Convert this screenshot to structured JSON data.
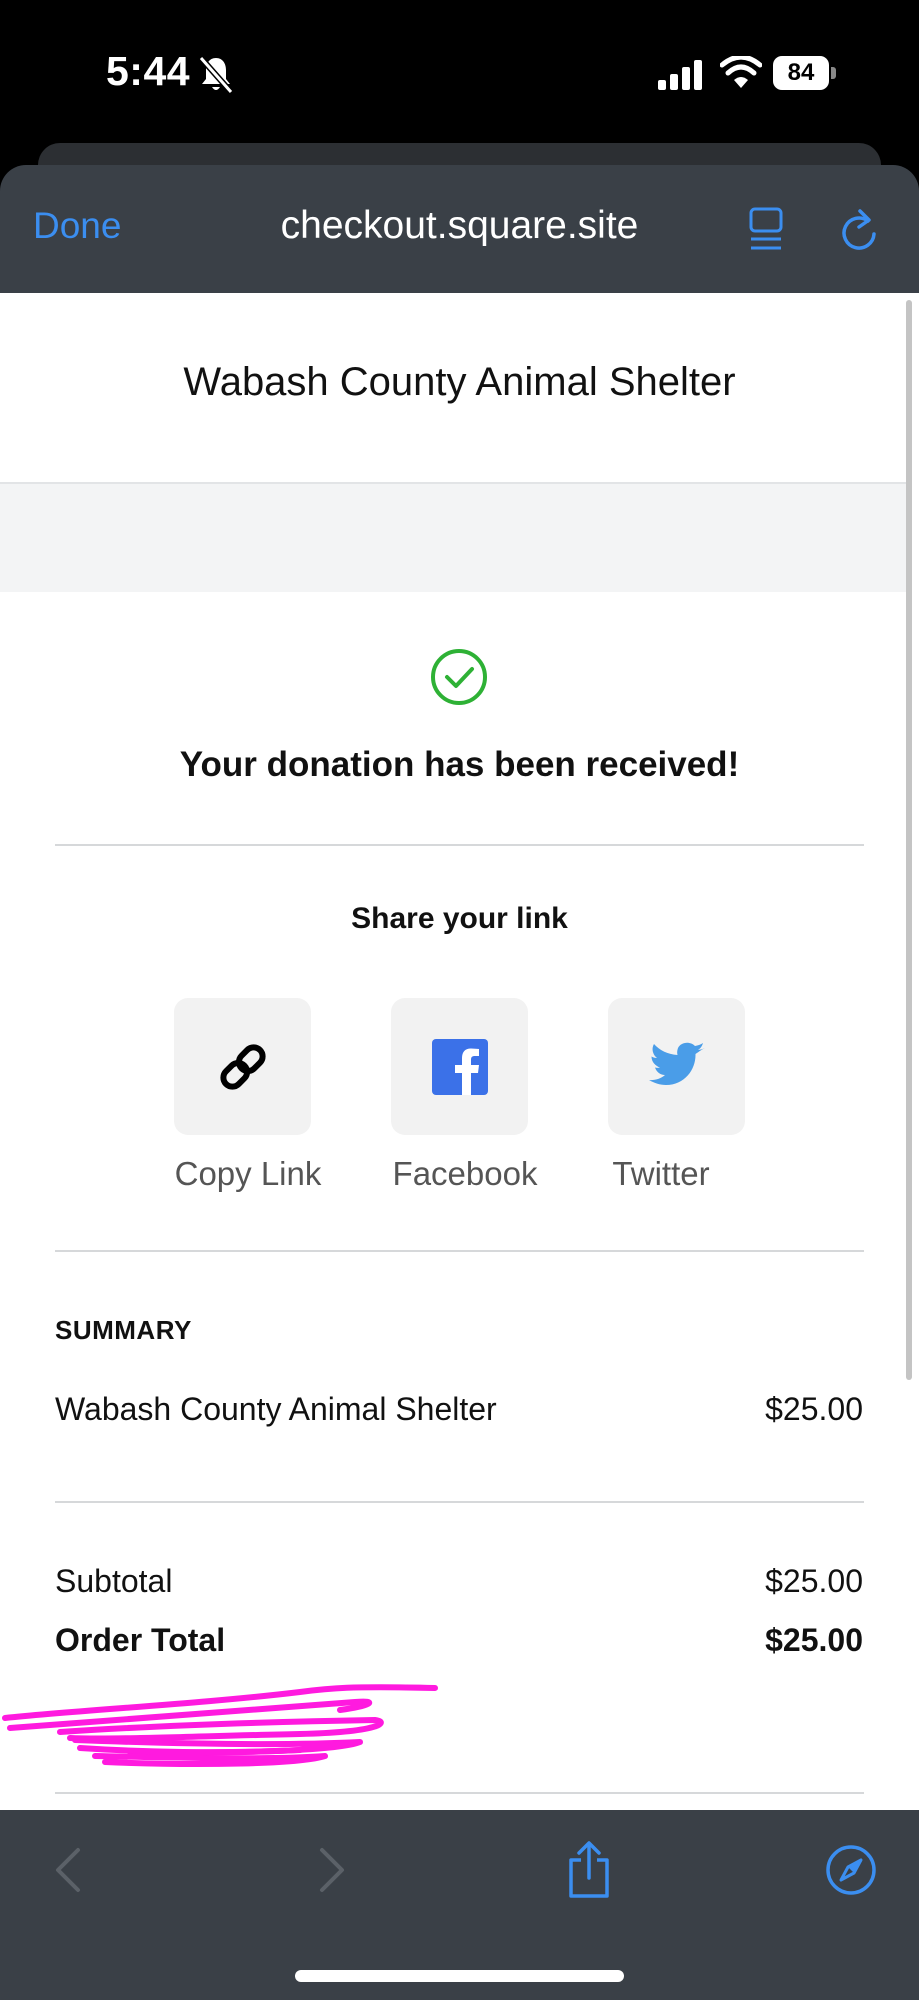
{
  "status_bar": {
    "time": "5:44",
    "battery": "84"
  },
  "browser": {
    "done_label": "Done",
    "url": "checkout.square.site"
  },
  "page": {
    "shop_title": "Wabash County Animal Shelter",
    "confirmation": "Your donation has been received!",
    "share": {
      "title": "Share your link",
      "options": [
        {
          "label": "Copy Link",
          "icon": "link-icon"
        },
        {
          "label": "Facebook",
          "icon": "facebook-icon"
        },
        {
          "label": "Twitter",
          "icon": "twitter-icon"
        }
      ]
    },
    "summary": {
      "heading": "SUMMARY",
      "item": {
        "name": "Wabash County Animal Shelter",
        "price": "$25.00"
      },
      "subtotal_label": "Subtotal",
      "subtotal_value": "$25.00",
      "total_label": "Order Total",
      "total_value": "$25.00"
    }
  },
  "colors": {
    "accent": "#3b8ef0",
    "success": "#2eb135",
    "scribble": "#ff1adf",
    "facebook": "#3b71e8",
    "twitter": "#4a9de8"
  }
}
